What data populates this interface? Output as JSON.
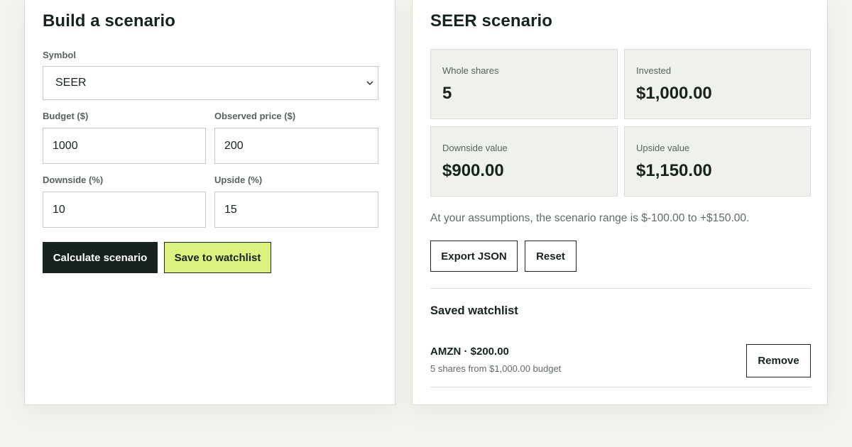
{
  "builder": {
    "title": "Build a scenario",
    "symbol_label": "Symbol",
    "symbol_value": "SEER",
    "budget_label": "Budget ($)",
    "budget_value": "1000",
    "price_label": "Observed price ($)",
    "price_value": "200",
    "downside_label": "Downside (%)",
    "downside_value": "10",
    "upside_label": "Upside (%)",
    "upside_value": "15",
    "calculate_label": "Calculate scenario",
    "save_label": "Save to watchlist"
  },
  "result": {
    "title": "SEER scenario",
    "stats": [
      {
        "label": "Whole shares",
        "value": "5"
      },
      {
        "label": "Invested",
        "value": "$1,000.00"
      },
      {
        "label": "Downside value",
        "value": "$900.00"
      },
      {
        "label": "Upside value",
        "value": "$1,150.00"
      }
    ],
    "summary": "At your assumptions, the scenario range is $-100.00 to +$150.00.",
    "export_label": "Export JSON",
    "reset_label": "Reset"
  },
  "watchlist": {
    "title": "Saved watchlist",
    "items": [
      {
        "name": "AMZN · $200.00",
        "detail": "5 shares from $1,000.00 budget",
        "remove_label": "Remove"
      }
    ]
  },
  "colors": {
    "accent_dark": "#17231d",
    "accent_lime": "#dcf280",
    "stat_bg": "#eff1ec",
    "page_bg": "#f4f4ef"
  }
}
